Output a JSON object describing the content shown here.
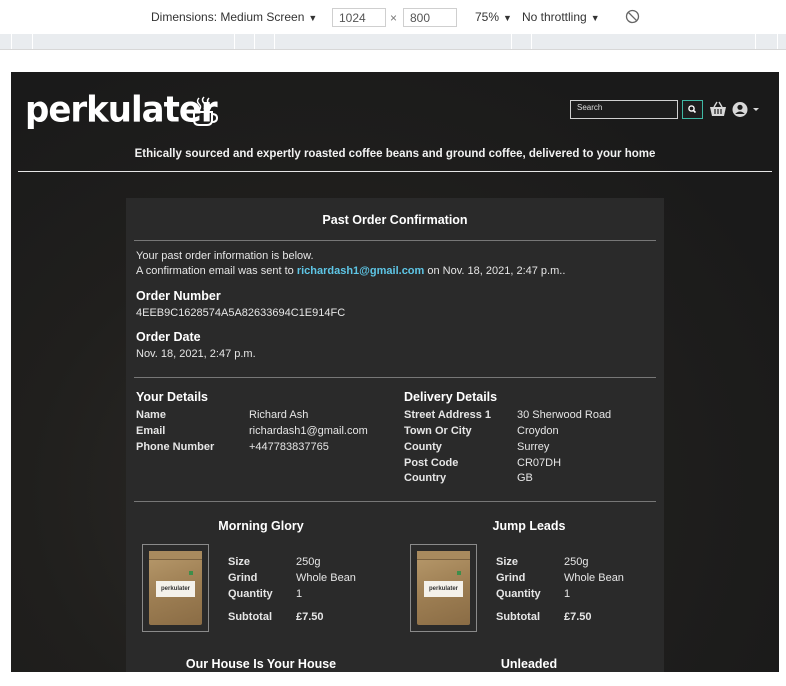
{
  "devtools": {
    "dimensions_label": "Dimensions: Medium Screen",
    "width": "1024",
    "times": "×",
    "height": "800",
    "zoom": "75%",
    "throttling": "No throttling"
  },
  "header": {
    "logo": "perkulater",
    "search_placeholder": "Search",
    "tagline": "Ethically sourced and expertly roasted coffee beans and ground coffee, delivered to your home"
  },
  "confirmation": {
    "title": "Past Order Confirmation",
    "intro_line1": "Your past order information is below.",
    "intro_line2_prefix": "A confirmation email was sent to",
    "email": "richardash1@gmail.com",
    "intro_line2_suffix": "on Nov. 18, 2021, 2:47 p.m..",
    "order_number_label": "Order Number",
    "order_number": "4EEB9C1628574A5A82633694C1E914FC",
    "order_date_label": "Order Date",
    "order_date": "Nov. 18, 2021, 2:47 p.m."
  },
  "your_details": {
    "heading": "Your Details",
    "rows": [
      {
        "label": "Name",
        "value": "Richard Ash"
      },
      {
        "label": "Email",
        "value": "richardash1@gmail.com"
      },
      {
        "label": "Phone Number",
        "value": "+447783837765"
      }
    ]
  },
  "delivery_details": {
    "heading": "Delivery Details",
    "rows": [
      {
        "label": "Street Address 1",
        "value": "30 Sherwood Road"
      },
      {
        "label": "Town Or City",
        "value": "Croydon"
      },
      {
        "label": "County",
        "value": "Surrey"
      },
      {
        "label": "Post Code",
        "value": "CR07DH"
      },
      {
        "label": "Country",
        "value": "GB"
      }
    ]
  },
  "items": [
    {
      "name": "Morning Glory",
      "size_label": "Size",
      "size": "250g",
      "grind_label": "Grind",
      "grind": "Whole Bean",
      "qty_label": "Quantity",
      "qty": "1",
      "subtotal_label": "Subtotal",
      "subtotal": "£7.50",
      "bag_text": "perkulater"
    },
    {
      "name": "Jump Leads",
      "size_label": "Size",
      "size": "250g",
      "grind_label": "Grind",
      "grind": "Whole Bean",
      "qty_label": "Quantity",
      "qty": "1",
      "subtotal_label": "Subtotal",
      "subtotal": "£7.50",
      "bag_text": "perkulater"
    },
    {
      "name": "Our House Is Your House"
    },
    {
      "name": "Unleaded"
    }
  ],
  "colors": {
    "accent": "#3fb8a4",
    "link": "#5ec6e6",
    "background": "#1d1d1d",
    "card": "#2a2a2a"
  }
}
